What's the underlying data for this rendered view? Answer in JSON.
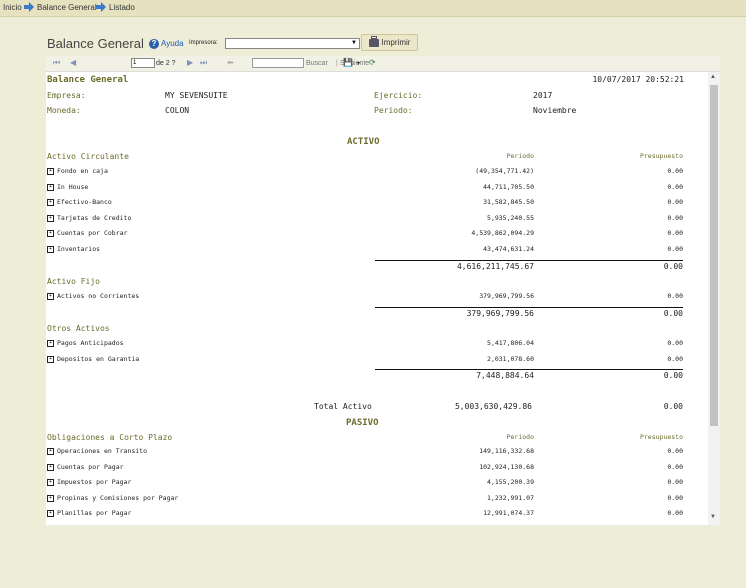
{
  "breadcrumb": [
    "Inicio",
    "Balance General",
    "Listado"
  ],
  "header": {
    "title": "Balance General",
    "help_label": "Ayuda",
    "printer_label": "Impresora:",
    "printer_value": "",
    "print_button": "Imprimir"
  },
  "toolbar": {
    "page_value": "1",
    "page_of": "de 2 ?",
    "search_value": "",
    "find_label": "Buscar",
    "separator": "|",
    "next_label": "Siguiente"
  },
  "report": {
    "title": "Balance General",
    "datetime": "10/07/2017 20:52:21",
    "empresa_label": "Empresa:",
    "empresa_value": "MY SEVENSUITE",
    "moneda_label": "Moneda:",
    "moneda_value": "COLON",
    "ejercicio_label": "Ejercicio:",
    "ejercicio_value": "2017",
    "periodo_label": "Periodo:",
    "periodo_value": "Noviembre",
    "activo_heading": "ACTIVO",
    "pasivo_heading": "PASIVO",
    "col_periodo": "Periodo",
    "col_presupuesto": "Presupuesto",
    "activo_circulante": {
      "label": "Activo Circulante",
      "rows": [
        {
          "name": "Fondo en caja",
          "periodo": "(49,354,771.42)",
          "presupuesto": "0.00"
        },
        {
          "name": "In House",
          "periodo": "44,711,705.50",
          "presupuesto": "0.00"
        },
        {
          "name": "Efectivo-Banco",
          "periodo": "31,582,845.50",
          "presupuesto": "0.00"
        },
        {
          "name": "Tarjetas de Credito",
          "periodo": "5,935,240.55",
          "presupuesto": "0.00"
        },
        {
          "name": "Cuentas por Cobrar",
          "periodo": "4,539,862,094.29",
          "presupuesto": "0.00"
        },
        {
          "name": "Inventarios",
          "periodo": "43,474,631.24",
          "presupuesto": "0.00"
        }
      ],
      "total_periodo": "4,616,211,745.67",
      "total_presupuesto": "0.00"
    },
    "activo_fijo": {
      "label": "Activo Fijo",
      "rows": [
        {
          "name": "Activos no Corrientes",
          "periodo": "379,969,799.56",
          "presupuesto": "0.00"
        }
      ],
      "total_periodo": "379,969,799.56",
      "total_presupuesto": "0.00"
    },
    "otros_activos": {
      "label": "Otros Activos",
      "rows": [
        {
          "name": "Pagos Anticipados",
          "periodo": "5,417,806.04",
          "presupuesto": "0.00"
        },
        {
          "name": "Depositos en Garantia",
          "periodo": "2,031,078.60",
          "presupuesto": "0.00"
        }
      ],
      "total_periodo": "7,448,884.64",
      "total_presupuesto": "0.00"
    },
    "total_activo_label": "Total Activo",
    "total_activo_periodo": "5,003,630,429.86",
    "total_activo_presupuesto": "0.00",
    "obligaciones": {
      "label": "Obligaciones a Corto Plazo",
      "rows": [
        {
          "name": "Operaciones en Transito",
          "periodo": "149,116,332.68",
          "presupuesto": "0.00"
        },
        {
          "name": "Cuentas por Pagar",
          "periodo": "102,924,130.68",
          "presupuesto": "0.00"
        },
        {
          "name": "Impuestos por Pagar",
          "periodo": "4,155,200.39",
          "presupuesto": "0.00"
        },
        {
          "name": "Propinas y Comisiones por Pagar",
          "periodo": "1,232,991.07",
          "presupuesto": "0.00"
        },
        {
          "name": "Planillas por Pagar",
          "periodo": "12,991,074.37",
          "presupuesto": "0.00"
        }
      ]
    }
  }
}
